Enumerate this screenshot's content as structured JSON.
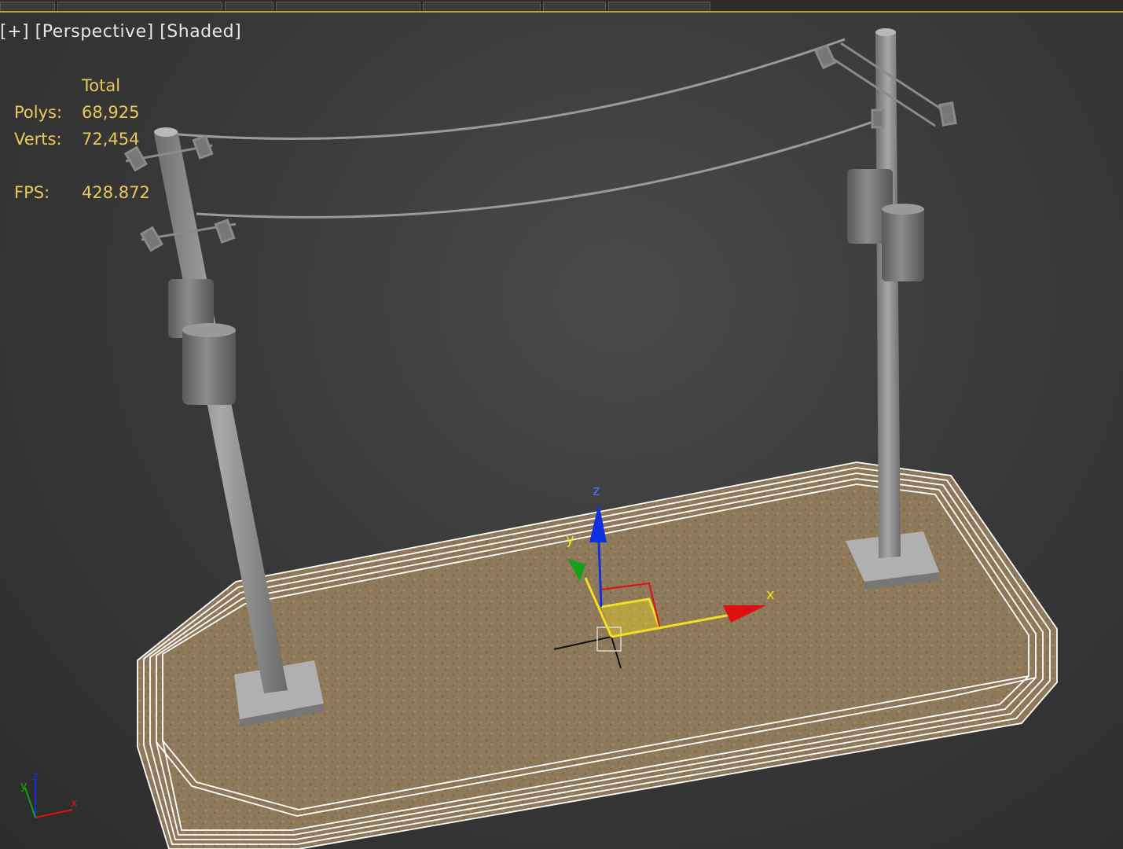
{
  "viewport": {
    "plus_label": "[+]",
    "view_label": "[Perspective]",
    "shading_label": "[Shaded]"
  },
  "stats": {
    "header": "Total",
    "polys_label": "Polys:",
    "polys_value": "68,925",
    "verts_label": "Verts:",
    "verts_value": "72,454",
    "fps_label": "FPS:",
    "fps_value": "428.872"
  },
  "gizmo": {
    "x_label": "x",
    "y_label": "y",
    "z_label": "z"
  },
  "axis_tripod": {
    "x_label": "x",
    "y_label": "y",
    "z_label": "z"
  },
  "colors": {
    "stats_text": "#e8c95a",
    "toolbar_accent": "#b59a3a",
    "axis_x": "#e01010",
    "axis_y": "#18a018",
    "axis_z": "#1030e0",
    "gizmo_plane": "#f0e020",
    "wireframe": "#ffffff",
    "ground": "#9c8463",
    "pole": "#8c8c8c"
  }
}
